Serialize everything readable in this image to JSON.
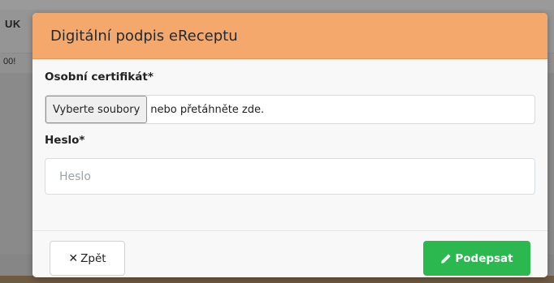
{
  "background": {
    "header_fragment": "UK",
    "row_fragment": "00!"
  },
  "modal": {
    "title": "Digitální podpis eReceptu",
    "header_color": "#f5a86b",
    "certificate": {
      "label": "Osobní certifikát*",
      "choose_button": "Vyberte soubory",
      "drop_hint": "nebo přetáhněte zde."
    },
    "password": {
      "label": "Heslo*",
      "placeholder": "Heslo",
      "value": ""
    },
    "footer": {
      "back_label": "Zpět",
      "back_icon": "close-icon",
      "sign_label": "Podepsat",
      "sign_icon": "pencil-icon",
      "sign_color": "#2bb84f"
    }
  }
}
